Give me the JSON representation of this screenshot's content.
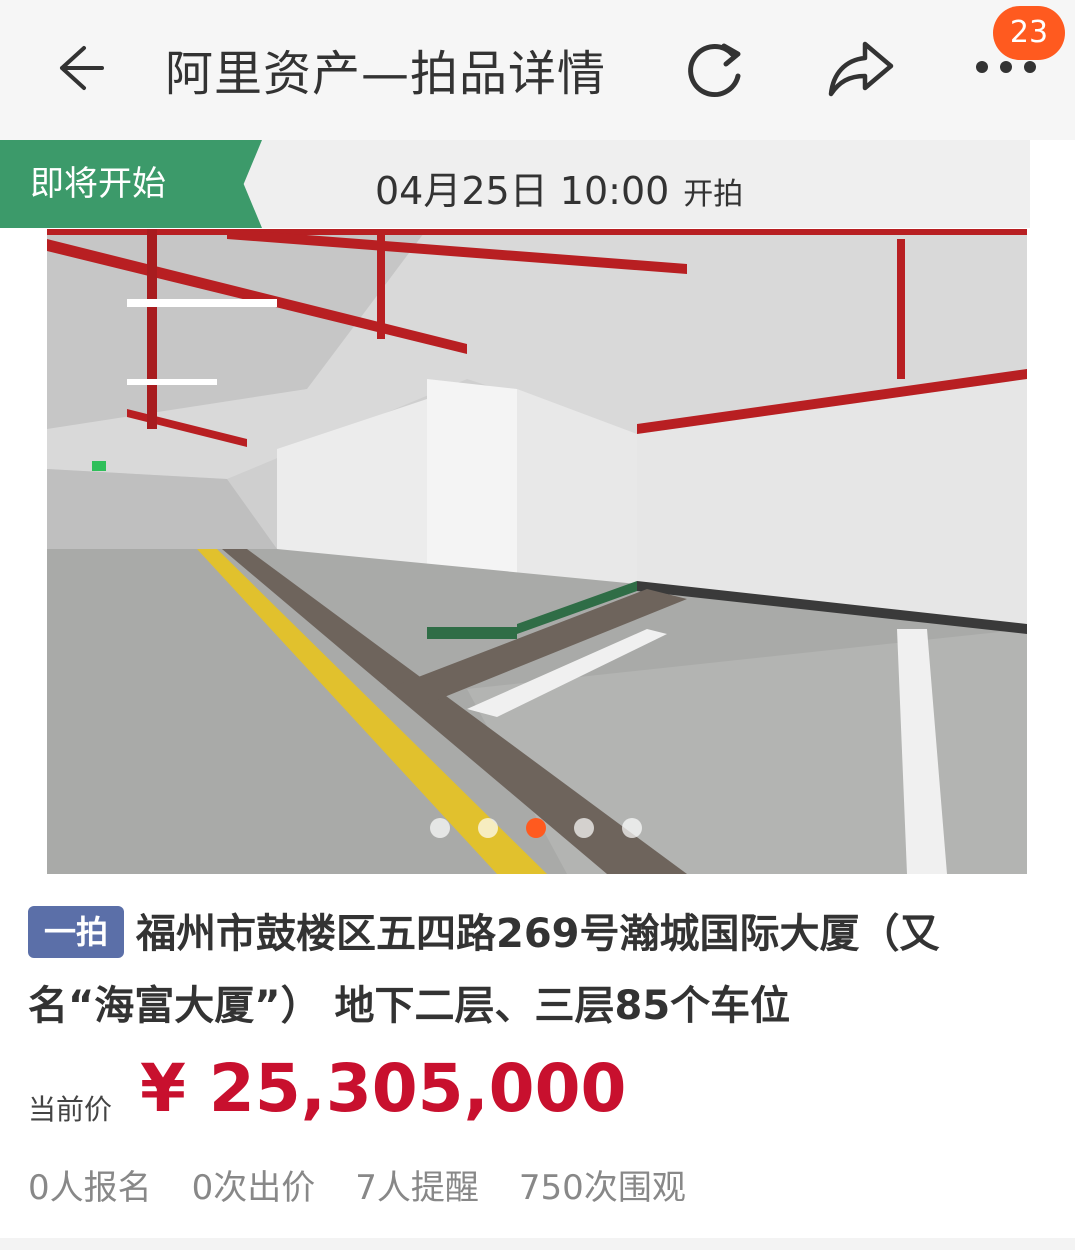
{
  "header": {
    "title": "阿里资产—拍品详情",
    "badge_count": "23",
    "icons": [
      "back-arrow-icon",
      "refresh-icon",
      "share-icon",
      "more-icon"
    ]
  },
  "status": {
    "tag": "即将开始",
    "date_time": "04月25日 10:00",
    "suffix": "开拍"
  },
  "gallery": {
    "slide_count": 5,
    "active_index": 2
  },
  "lot": {
    "tag": "一拍",
    "title": "福州市鼓楼区五四路269号瀚城国际大厦（又名“海富大厦”） 地下二层、三层85个车位"
  },
  "price": {
    "label": "当前价",
    "value": "¥ 25,305,000"
  },
  "stats": {
    "signups": "0人报名",
    "bids": "0次出价",
    "reminders": "7人提醒",
    "views": "750次围观"
  },
  "colors": {
    "status_green": "#3c9a6a",
    "badge_orange": "#ff5a1f",
    "price_red": "#c8102e",
    "lot_tag_blue": "#5b6fa8"
  }
}
